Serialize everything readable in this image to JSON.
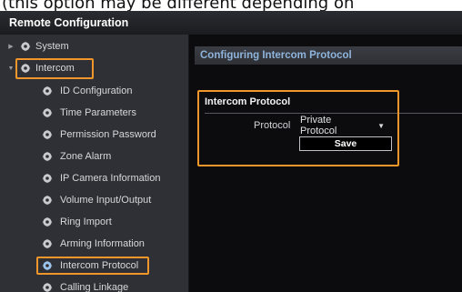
{
  "caption": "(this option may be different depending on",
  "window": {
    "title": "Remote Configuration"
  },
  "sidebar": {
    "items": [
      {
        "label": "System",
        "icon": "gear-icon",
        "expanded": false
      },
      {
        "label": "Intercom",
        "icon": "gear-icon",
        "expanded": true
      }
    ],
    "children": [
      {
        "label": "ID Configuration"
      },
      {
        "label": "Time Parameters"
      },
      {
        "label": "Permission Password"
      },
      {
        "label": "Zone Alarm"
      },
      {
        "label": "IP Camera Information"
      },
      {
        "label": "Volume Input/Output"
      },
      {
        "label": "Ring Import"
      },
      {
        "label": "Arming Information"
      },
      {
        "label": "Intercom Protocol",
        "selected": true
      },
      {
        "label": "Calling Linkage"
      }
    ]
  },
  "content": {
    "section_title": "Configuring Intercom Protocol",
    "panel_title": "Intercom Protocol",
    "protocol_label": "Protocol",
    "protocol_value": "Private Protocol",
    "save_label": "Save"
  },
  "colors": {
    "highlight": "#f0962a",
    "section_title_text": "#8fb4dc",
    "sidebar_bg": "#2e3035",
    "content_bg": "#0c0c0e"
  }
}
